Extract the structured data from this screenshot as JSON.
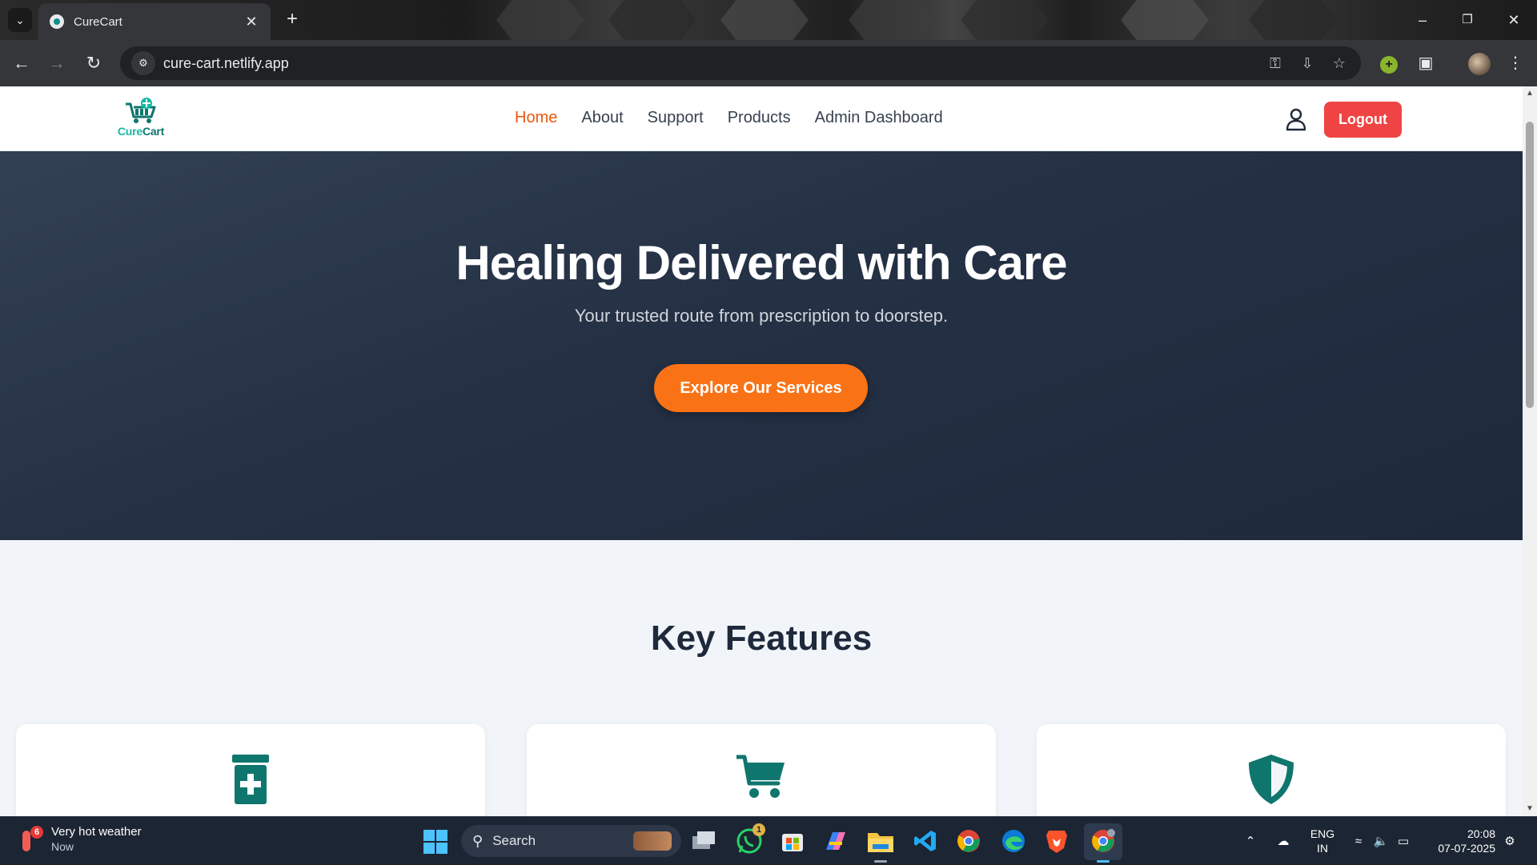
{
  "browser": {
    "tab_title": "CureCart",
    "url": "cure-cart.netlify.app"
  },
  "site_nav": {
    "logo_text_a": "Cure",
    "logo_text_b": "Cart",
    "menu": [
      {
        "label": "Home",
        "active": true
      },
      {
        "label": "About",
        "active": false
      },
      {
        "label": "Support",
        "active": false
      },
      {
        "label": "Products",
        "active": false
      },
      {
        "label": "Admin Dashboard",
        "active": false
      }
    ],
    "logout_label": "Logout"
  },
  "hero": {
    "title": "Healing Delivered with Care",
    "subtitle": "Your trusted route from prescription to doorstep.",
    "cta_label": "Explore Our Services"
  },
  "features": {
    "title": "Key Features",
    "cards": [
      {
        "icon": "prescription-bottle-icon"
      },
      {
        "icon": "shopping-cart-icon"
      },
      {
        "icon": "shield-icon"
      }
    ]
  },
  "colors": {
    "brand_teal": "#0f766e",
    "accent_orange": "#f97316",
    "active_link": "#ea580c",
    "logout_red": "#ef4444",
    "hero_bg": "#1e293b"
  },
  "taskbar": {
    "weather_title": "Very hot weather",
    "weather_time": "Now",
    "weather_badge": "6",
    "search_label": "Search",
    "whatsapp_badge": "1",
    "lang_line1": "ENG",
    "lang_line2": "IN",
    "time": "20:08",
    "date": "07-07-2025"
  }
}
